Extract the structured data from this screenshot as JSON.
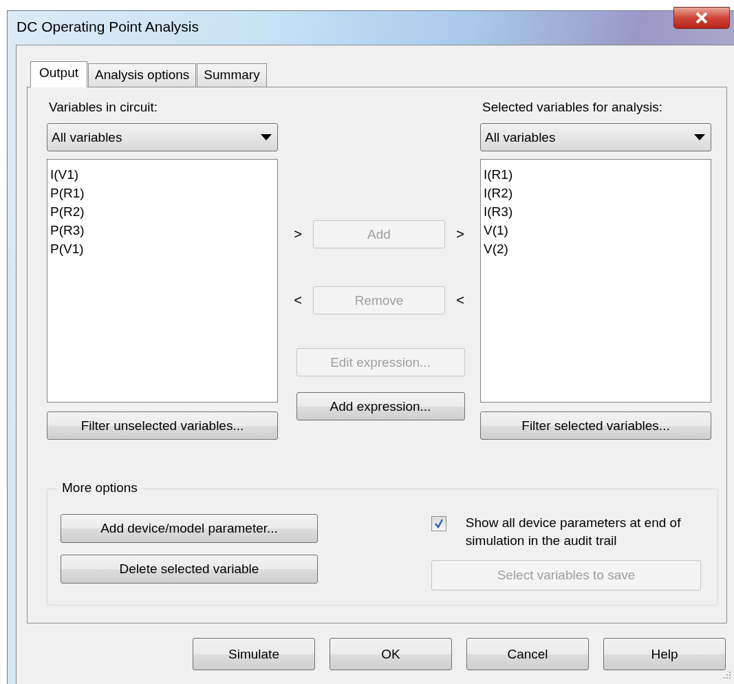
{
  "window": {
    "title": "DC Operating Point Analysis"
  },
  "tabs": [
    {
      "label": "Output",
      "selected": true
    },
    {
      "label": "Analysis options",
      "selected": false
    },
    {
      "label": "Summary",
      "selected": false
    }
  ],
  "left": {
    "label": "Variables in circuit:",
    "filter": "All variables",
    "items": [
      "I(V1)",
      "P(R1)",
      "P(R2)",
      "P(R3)",
      "P(V1)"
    ],
    "button": "Filter unselected variables..."
  },
  "transfer": [
    {
      "arrow_left": ">",
      "label": "Add",
      "arrow_right": ">",
      "disabled": true
    },
    {
      "arrow_left": "<",
      "label": "Remove",
      "arrow_right": "<",
      "disabled": true
    }
  ],
  "expression_buttons": [
    {
      "label": "Edit expression...",
      "disabled": true
    },
    {
      "label": "Add expression...",
      "disabled": false
    }
  ],
  "right": {
    "label": "Selected variables for analysis:",
    "filter": "All variables",
    "items": [
      "I(R1)",
      "I(R2)",
      "I(R3)",
      "V(1)",
      "V(2)"
    ],
    "button": "Filter selected variables..."
  },
  "more_options": {
    "title": "More options",
    "buttons": [
      {
        "label": "Add device/model parameter...",
        "disabled": false
      },
      {
        "label": "Delete selected variable",
        "disabled": false
      }
    ],
    "checkbox": {
      "label": "Show all device parameters at end of simulation in the audit trail",
      "checked": true
    },
    "save_button": {
      "label": "Select variables to save",
      "disabled": true
    }
  },
  "buttons": [
    {
      "label": "Simulate"
    },
    {
      "label": "OK"
    },
    {
      "label": "Cancel"
    },
    {
      "label": "Help"
    }
  ]
}
